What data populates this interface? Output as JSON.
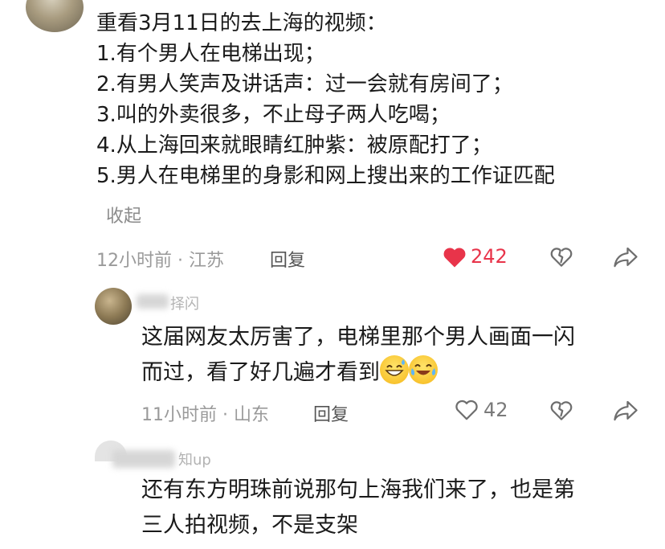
{
  "comment": {
    "lines": [
      "重看3月11日的去上海的视频：",
      "1.有个男人在电梯出现；",
      "2.有男人笑声及讲话声：过一会就有房间了；",
      "3.叫的外卖很多，不止母子两人吃喝；",
      "4.从上海回来就眼睛红肿紫：被原配打了；",
      "5.男人在电梯里的身影和网上搜出来的工作证匹配"
    ],
    "collapse_label": "收起",
    "time_location": "12小时前 · 江苏",
    "reply_label": "回复",
    "like_count": "242",
    "like_color": "#e8344a"
  },
  "reply1": {
    "name_fragment": "择闪",
    "lines": [
      "这届网友太厉害了，电梯里那个男人画面一闪",
      "而过，看了好几遍才看到"
    ],
    "emojis": [
      "grinning-sweat-emoji",
      "laughing-tears-emoji"
    ],
    "time_location": "11小时前 · 山东",
    "reply_label": "回复",
    "like_count": "42"
  },
  "reply2": {
    "name_fragment": "知up",
    "lines": [
      "还有东方明珠前说那句上海我们来了，也是第",
      "三人拍视频，不是支架"
    ]
  }
}
